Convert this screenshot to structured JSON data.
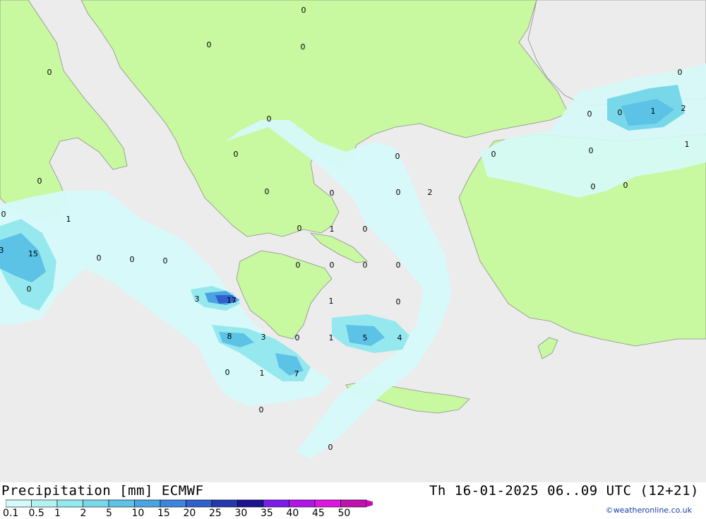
{
  "title": "Precipitation [mm] ECMWF",
  "timestamp": "Th 16-01-2025 06..09 UTC (12+21)",
  "credit": "©weatheronline.co.uk",
  "colors": {
    "sea": "#ececec",
    "land": "#c8f8a0",
    "border": "#8f8f8f"
  },
  "legend": {
    "ticks": [
      "0.1",
      "0.5",
      "1",
      "2",
      "5",
      "10",
      "15",
      "20",
      "25",
      "30",
      "35",
      "40",
      "45",
      "50"
    ],
    "colors": [
      "#d6fafa",
      "#b4f2f2",
      "#96e8ef",
      "#78d8ea",
      "#5cc2e6",
      "#4aa4e2",
      "#3c84dc",
      "#3060cc",
      "#2438b0",
      "#1a1490",
      "#7a1ce8",
      "#b014e8",
      "#e014e0",
      "#c010b0"
    ]
  },
  "map_labels": [
    "0",
    "0",
    "0",
    "0",
    "0",
    "0",
    "0",
    "0",
    "1",
    "2",
    "1",
    "0",
    "0",
    "0",
    "0",
    "0",
    "0",
    "0",
    "0",
    "2",
    "0",
    "0",
    "0",
    "1",
    "0",
    "1",
    "0",
    "15",
    "3",
    "0",
    "0",
    "0",
    "0",
    "0",
    "0",
    "0",
    "0",
    "3",
    "17",
    "1",
    "0",
    "8",
    "3",
    "0",
    "1",
    "5",
    "4",
    "0",
    "1",
    "7",
    "0",
    "0"
  ]
}
